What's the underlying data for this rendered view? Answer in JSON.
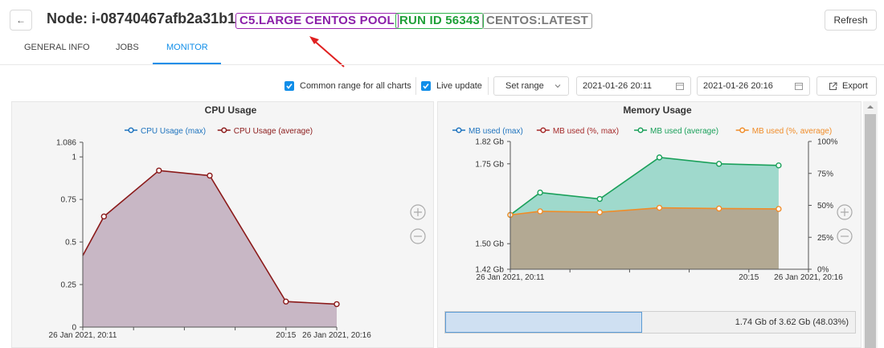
{
  "header": {
    "back_icon": "←",
    "title": "Node: i-08740467afb2a31b1",
    "tags": {
      "pool": "C5.LARGE CENTOS POOL",
      "run": "RUN ID 56343",
      "image": "CENTOS:LATEST"
    },
    "refresh_label": "Refresh"
  },
  "tabs": [
    {
      "label": "GENERAL INFO",
      "active": false
    },
    {
      "label": "JOBS",
      "active": false
    },
    {
      "label": "MONITOR",
      "active": true
    }
  ],
  "toolbar": {
    "common_range_label": "Common range for all charts",
    "common_range_checked": true,
    "live_update_label": "Live update",
    "live_update_checked": true,
    "set_range_label": "Set range",
    "date_from": "2021-01-26 20:11",
    "date_to": "2021-01-26 20:16",
    "export_label": "Export"
  },
  "colors": {
    "accent": "#108ee9",
    "cpu_max": "#1e73be",
    "cpu_avg": "#8b1a1a",
    "cpu_fill": "#c5b3c2",
    "mem_used_max": "#1e73be",
    "mem_used_pct_max": "#a52a2a",
    "mem_used_avg": "#1aa05a",
    "mem_used_pct_avg": "#f08c28",
    "annotation_arrow": "#e02020"
  },
  "chart_data": [
    {
      "type": "area",
      "title": "CPU Usage",
      "xlabel": "",
      "ylabel": "",
      "x_tick_labels": [
        "26 Jan 2021, 20:11",
        "20:15",
        "26 Jan 2021, 20:16"
      ],
      "y_tick_labels": [
        "0",
        "0.25",
        "0.5",
        "0.75",
        "1",
        "1.086"
      ],
      "ylim": [
        0,
        1.086
      ],
      "grid": false,
      "legend_position": "top",
      "series": [
        {
          "name": "CPU Usage (max)",
          "values": []
        },
        {
          "name": "CPU Usage (average)",
          "x": [
            "20:11:00",
            "20:11:25",
            "20:12:30",
            "20:13:30",
            "20:15:00",
            "20:16:00"
          ],
          "values": [
            0.42,
            0.65,
            0.92,
            0.89,
            0.15,
            0.135
          ],
          "markers": [
            false,
            true,
            true,
            true,
            true,
            true
          ]
        }
      ],
      "zoom_in_icon": "plus-circle-icon",
      "zoom_out_icon": "minus-circle-icon"
    },
    {
      "type": "area",
      "title": "Memory Usage",
      "xlabel": "",
      "ylabel": "",
      "x_tick_labels": [
        "26 Jan 2021, 20:11",
        "20:15",
        "26 Jan 2021, 20:16"
      ],
      "y_left_tick_labels": [
        "1.42 Gb",
        "1.50 Gb",
        "1.75 Gb",
        "1.82 Gb"
      ],
      "y_right_tick_labels": [
        "0%",
        "25%",
        "50%",
        "75%",
        "100%"
      ],
      "ylim_left": [
        1.42,
        1.82
      ],
      "ylim_right": [
        0,
        100
      ],
      "grid": false,
      "legend_position": "top",
      "series": [
        {
          "name": "MB used (max)",
          "values": []
        },
        {
          "name": "MB used (%, max)",
          "values": []
        },
        {
          "name": "MB used (average)",
          "axis": "left",
          "x": [
            "20:11:00",
            "20:11:30",
            "20:12:30",
            "20:13:30",
            "20:14:30",
            "20:15:30"
          ],
          "values": [
            1.59,
            1.66,
            1.64,
            1.77,
            1.75,
            1.745
          ]
        },
        {
          "name": "MB used (%, average)",
          "axis": "right",
          "x": [
            "20:11:00",
            "20:11:30",
            "20:12:30",
            "20:13:30",
            "20:14:30",
            "20:15:30"
          ],
          "values": [
            42.5,
            45.3,
            44.6,
            48.1,
            47.5,
            47.2
          ]
        }
      ],
      "memory_summary": {
        "text": "1.74 Gb of 3.62 Gb (48.03%)",
        "fraction": 0.4803
      },
      "zoom_in_icon": "plus-circle-icon",
      "zoom_out_icon": "minus-circle-icon"
    }
  ]
}
